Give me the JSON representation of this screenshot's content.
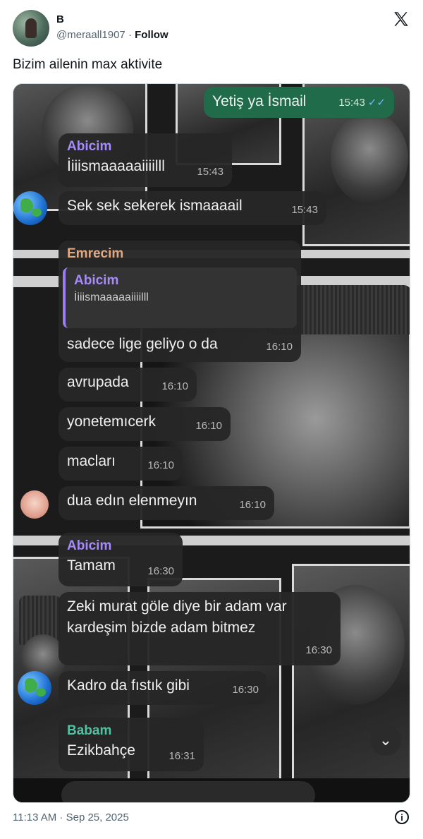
{
  "tweet": {
    "name": "B",
    "handle": "@meraall1907",
    "separator": " · ",
    "follow": "Follow",
    "text": "Bizim ailenin max aktivite",
    "footer_time": "11:13 AM · Sep 25, 2025"
  },
  "chat": {
    "messages": [
      {
        "text": "Yetiş ya İsmail",
        "time": "15:43",
        "ticks": "✓✓"
      },
      {
        "sender": "Abicim",
        "text": "İiiismaaaaaiiiilll",
        "time": "15:43"
      },
      {
        "text": "Sek sek sekerek ismaaaail",
        "time": "15:43"
      },
      {
        "sender": "Emrecim",
        "quote_sender": "Abicim",
        "quote_text": "İiiismaaaaaiiiilll",
        "text": "sadece lige geliyo o da",
        "time": "16:10"
      },
      {
        "text": "avrupada",
        "time": "16:10"
      },
      {
        "text": "yonetemıcerk",
        "time": "16:10"
      },
      {
        "text": "macları",
        "time": "16:10"
      },
      {
        "text": "dua edın elenmeyın",
        "time": "16:10"
      },
      {
        "sender": "Abicim",
        "text": "Tamam",
        "time": "16:30"
      },
      {
        "text_line1": "Zeki murat göle diye bir adam var",
        "text_line2": "kardeşim bizde adam bitmez",
        "time": "16:30"
      },
      {
        "text": "Kadro da fıstık gibi",
        "time": "16:30"
      },
      {
        "sender": "Babam",
        "text": "Ezikbahçe",
        "time": "16:31"
      }
    ],
    "colors": {
      "abicim": "#a78bfa",
      "emrecim": "#e3a77f",
      "babam": "#4fc3a1",
      "outgoing": "#1f6b4a"
    }
  },
  "icons": {
    "scroll": "⌄",
    "info": "i"
  }
}
